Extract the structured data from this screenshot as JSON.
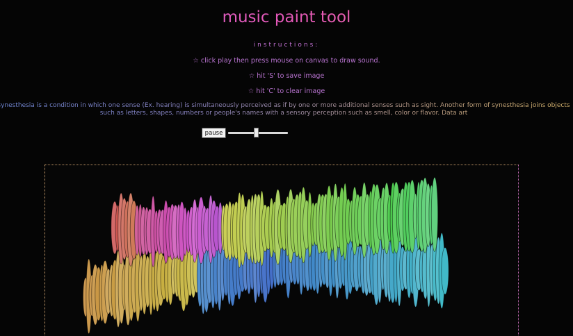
{
  "page": {
    "title": "music paint tool",
    "instructions_heading": "instructions:",
    "instructions": [
      "☆ click play then press mouse on canvas to draw sound.",
      "☆ hit 'S' to save image",
      "☆ hit 'C' to clear image"
    ],
    "description": "synesthesia is a condition in which one sense (Ex. hearing) is simultaneously perceived as if by one or more additional senses such as sight. Another form of synesthesia joins objects such as letters, shapes, numbers or people's names with a sensory perception such as smell, color or flavor. Data art"
  },
  "controls": {
    "pause_label": "pause",
    "volume_level": 0.48
  },
  "colors": {
    "title": "#e060c0",
    "instructions": "#b974d1",
    "canvas_border": "#c49a6a",
    "background": "#050505"
  }
}
